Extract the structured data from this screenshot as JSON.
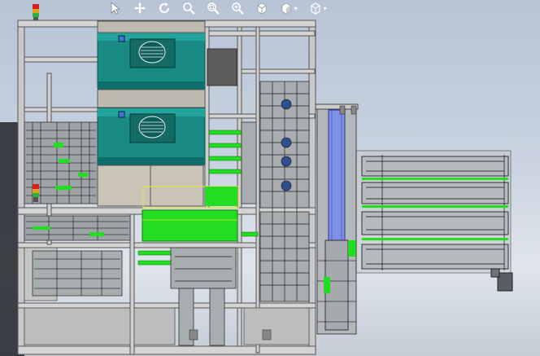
{
  "toolbar": {
    "tools": [
      {
        "icon": "select-arrow-icon"
      },
      {
        "icon": "pan-icon"
      },
      {
        "icon": "rotate-icon"
      },
      {
        "icon": "zoom-to-fit-icon"
      },
      {
        "icon": "zoom-to-area-icon"
      },
      {
        "icon": "zoom-in-out-icon"
      },
      {
        "icon": "view-orientation-icon"
      },
      {
        "icon": "display-style-icon"
      },
      {
        "icon": "hide-show-items-icon"
      }
    ]
  },
  "colors": {
    "background_top": "#b7c4d6",
    "background_bottom": "#e0e5ec",
    "frame": "#d2d2d2",
    "frame_edge": "#555555",
    "cabinet_teal": "#1a8a84",
    "highlight_green": "#22dd22",
    "conveyor_blue": "#7f90e8",
    "selection_yellow": "#e8e040",
    "toolbar_icon": "#ffffff"
  }
}
